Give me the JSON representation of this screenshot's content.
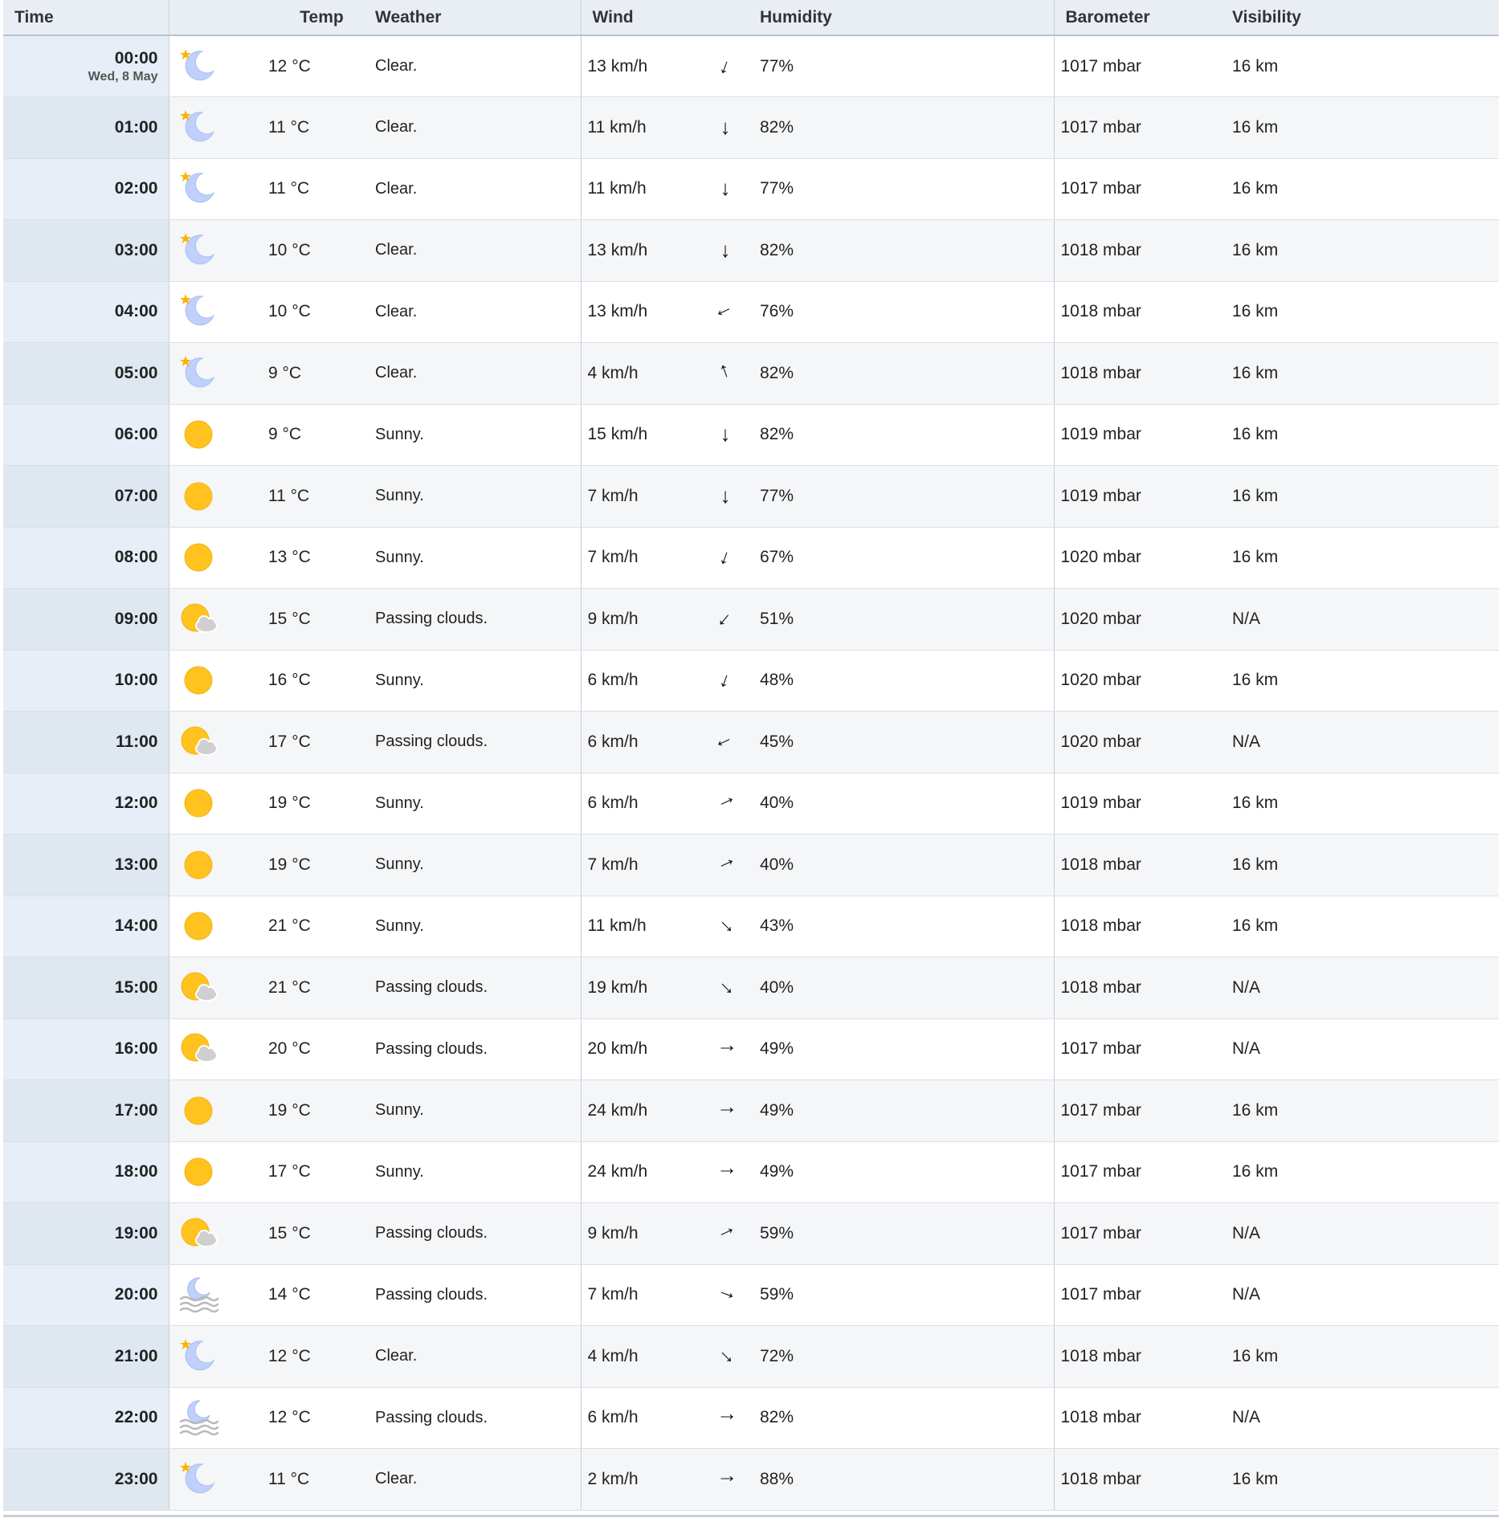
{
  "headers": {
    "time": "Time",
    "temp": "Temp",
    "weather": "Weather",
    "wind": "Wind",
    "humidity": "Humidity",
    "barometer": "Barometer",
    "visibility": "Visibility"
  },
  "date_label": "Wed, 8 May",
  "rows": [
    {
      "time": "00:00",
      "icon": "moon-icon",
      "temp": "12 °C",
      "weather": "Clear.",
      "wind": "13 km/h",
      "wind_dir_deg": 20,
      "humidity": "77%",
      "barometer": "1017 mbar",
      "visibility": "16 km"
    },
    {
      "time": "01:00",
      "icon": "moon-icon",
      "temp": "11 °C",
      "weather": "Clear.",
      "wind": "11 km/h",
      "wind_dir_deg": 0,
      "humidity": "82%",
      "barometer": "1017 mbar",
      "visibility": "16 km"
    },
    {
      "time": "02:00",
      "icon": "moon-icon",
      "temp": "11 °C",
      "weather": "Clear.",
      "wind": "11 km/h",
      "wind_dir_deg": 0,
      "humidity": "77%",
      "barometer": "1017 mbar",
      "visibility": "16 km"
    },
    {
      "time": "03:00",
      "icon": "moon-icon",
      "temp": "10 °C",
      "weather": "Clear.",
      "wind": "13 km/h",
      "wind_dir_deg": 0,
      "humidity": "82%",
      "barometer": "1018 mbar",
      "visibility": "16 km"
    },
    {
      "time": "04:00",
      "icon": "moon-icon",
      "temp": "10 °C",
      "weather": "Clear.",
      "wind": "13 km/h",
      "wind_dir_deg": 65,
      "humidity": "76%",
      "barometer": "1018 mbar",
      "visibility": "16 km"
    },
    {
      "time": "05:00",
      "icon": "moon-icon",
      "temp": "9 °C",
      "weather": "Clear.",
      "wind": "4 km/h",
      "wind_dir_deg": 160,
      "humidity": "82%",
      "barometer": "1018 mbar",
      "visibility": "16 km"
    },
    {
      "time": "06:00",
      "icon": "sun-icon",
      "temp": "9 °C",
      "weather": "Sunny.",
      "wind": "15 km/h",
      "wind_dir_deg": 0,
      "humidity": "82%",
      "barometer": "1019 mbar",
      "visibility": "16 km"
    },
    {
      "time": "07:00",
      "icon": "sun-icon",
      "temp": "11 °C",
      "weather": "Sunny.",
      "wind": "7 km/h",
      "wind_dir_deg": 0,
      "humidity": "77%",
      "barometer": "1019 mbar",
      "visibility": "16 km"
    },
    {
      "time": "08:00",
      "icon": "sun-icon",
      "temp": "13 °C",
      "weather": "Sunny.",
      "wind": "7 km/h",
      "wind_dir_deg": 20,
      "humidity": "67%",
      "barometer": "1020 mbar",
      "visibility": "16 km"
    },
    {
      "time": "09:00",
      "icon": "sun-cloud-icon",
      "temp": "15 °C",
      "weather": "Passing clouds.",
      "wind": "9 km/h",
      "wind_dir_deg": 40,
      "humidity": "51%",
      "barometer": "1020 mbar",
      "visibility": "N/A"
    },
    {
      "time": "10:00",
      "icon": "sun-icon",
      "temp": "16 °C",
      "weather": "Sunny.",
      "wind": "6 km/h",
      "wind_dir_deg": 20,
      "humidity": "48%",
      "barometer": "1020 mbar",
      "visibility": "16 km"
    },
    {
      "time": "11:00",
      "icon": "sun-cloud-icon",
      "temp": "17 °C",
      "weather": "Passing clouds.",
      "wind": "6 km/h",
      "wind_dir_deg": 65,
      "humidity": "45%",
      "barometer": "1020 mbar",
      "visibility": "N/A"
    },
    {
      "time": "12:00",
      "icon": "sun-icon",
      "temp": "19 °C",
      "weather": "Sunny.",
      "wind": "6 km/h",
      "wind_dir_deg": 245,
      "humidity": "40%",
      "barometer": "1019 mbar",
      "visibility": "16 km"
    },
    {
      "time": "13:00",
      "icon": "sun-icon",
      "temp": "19 °C",
      "weather": "Sunny.",
      "wind": "7 km/h",
      "wind_dir_deg": 245,
      "humidity": "40%",
      "barometer": "1018 mbar",
      "visibility": "16 km"
    },
    {
      "time": "14:00",
      "icon": "sun-icon",
      "temp": "21 °C",
      "weather": "Sunny.",
      "wind": "11 km/h",
      "wind_dir_deg": 315,
      "humidity": "43%",
      "barometer": "1018 mbar",
      "visibility": "16 km"
    },
    {
      "time": "15:00",
      "icon": "sun-cloud-icon",
      "temp": "21 °C",
      "weather": "Passing clouds.",
      "wind": "19 km/h",
      "wind_dir_deg": 315,
      "humidity": "40%",
      "barometer": "1018 mbar",
      "visibility": "N/A"
    },
    {
      "time": "16:00",
      "icon": "sun-cloud-icon",
      "temp": "20 °C",
      "weather": "Passing clouds.",
      "wind": "20 km/h",
      "wind_dir_deg": 270,
      "humidity": "49%",
      "barometer": "1017 mbar",
      "visibility": "N/A"
    },
    {
      "time": "17:00",
      "icon": "sun-icon",
      "temp": "19 °C",
      "weather": "Sunny.",
      "wind": "24 km/h",
      "wind_dir_deg": 270,
      "humidity": "49%",
      "barometer": "1017 mbar",
      "visibility": "16 km"
    },
    {
      "time": "18:00",
      "icon": "sun-icon",
      "temp": "17 °C",
      "weather": "Sunny.",
      "wind": "24 km/h",
      "wind_dir_deg": 270,
      "humidity": "49%",
      "barometer": "1017 mbar",
      "visibility": "16 km"
    },
    {
      "time": "19:00",
      "icon": "sun-cloud-icon",
      "temp": "15 °C",
      "weather": "Passing clouds.",
      "wind": "9 km/h",
      "wind_dir_deg": 245,
      "humidity": "59%",
      "barometer": "1017 mbar",
      "visibility": "N/A"
    },
    {
      "time": "20:00",
      "icon": "moon-fog-icon",
      "temp": "14 °C",
      "weather": "Passing clouds.",
      "wind": "7 km/h",
      "wind_dir_deg": 290,
      "humidity": "59%",
      "barometer": "1017 mbar",
      "visibility": "N/A"
    },
    {
      "time": "21:00",
      "icon": "moon-icon",
      "temp": "12 °C",
      "weather": "Clear.",
      "wind": "4 km/h",
      "wind_dir_deg": 315,
      "humidity": "72%",
      "barometer": "1018 mbar",
      "visibility": "16 km"
    },
    {
      "time": "22:00",
      "icon": "moon-fog-icon",
      "temp": "12 °C",
      "weather": "Passing clouds.",
      "wind": "6 km/h",
      "wind_dir_deg": 270,
      "humidity": "82%",
      "barometer": "1018 mbar",
      "visibility": "N/A"
    },
    {
      "time": "23:00",
      "icon": "moon-icon",
      "temp": "11 °C",
      "weather": "Clear.",
      "wind": "2 km/h",
      "wind_dir_deg": 270,
      "humidity": "88%",
      "barometer": "1018 mbar",
      "visibility": "16 km"
    }
  ],
  "colors": {
    "sun": "#FFC21F",
    "sun_edge": "#F3B416",
    "moon": "#BFD0FA",
    "moon_edge": "#A9BEF2",
    "star": "#F9B400",
    "cloud": "#CFCFCF",
    "fog": "#B9B9B9",
    "header_bg": "#E9EEF5",
    "time_col_bg": "#E7EEF7"
  }
}
